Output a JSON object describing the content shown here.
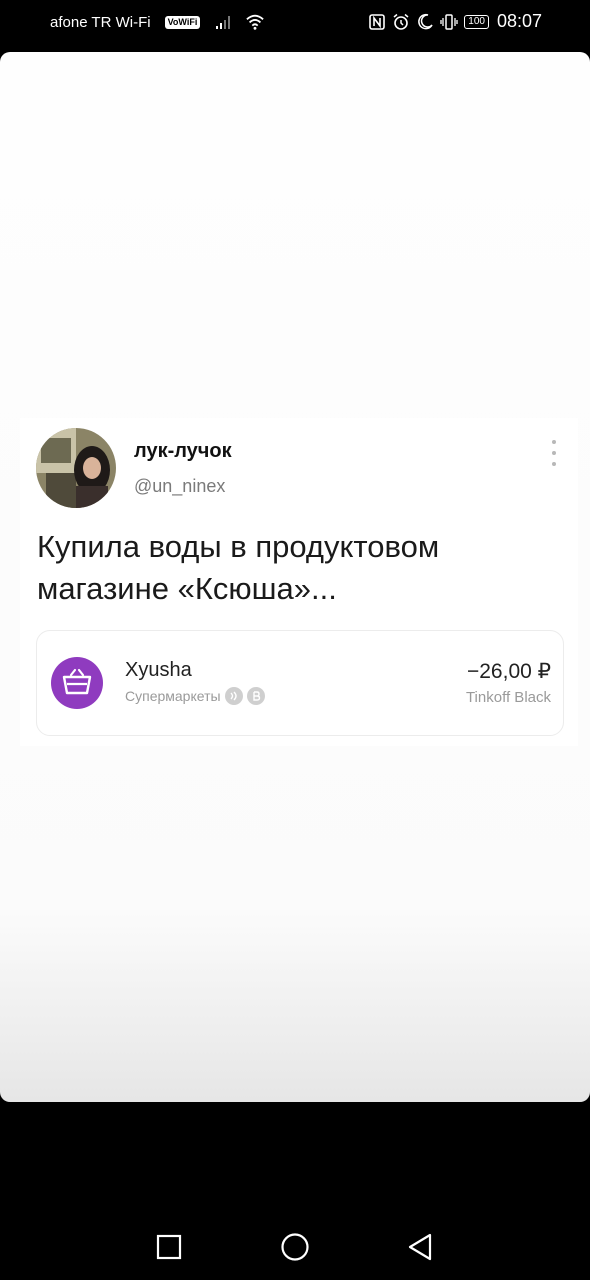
{
  "status_bar": {
    "carrier": "afone TR Wi-Fi",
    "vowifi": "VoWiFi",
    "battery": "100",
    "time": "08:07"
  },
  "tweet": {
    "display_name": "лук-лучок",
    "handle": "@un_ninex",
    "text": "Купила воды в продуктовом магазине «Ксюша»...",
    "transaction": {
      "merchant": "Xyusha",
      "category": "Супермаркеты",
      "amount": "−26,00 ₽",
      "card": "Tinkoff Black",
      "logo_color": "#8f3bbf"
    }
  },
  "navigation": {
    "icons": [
      "square-recents-icon",
      "circle-home-icon",
      "triangle-back-icon"
    ]
  }
}
